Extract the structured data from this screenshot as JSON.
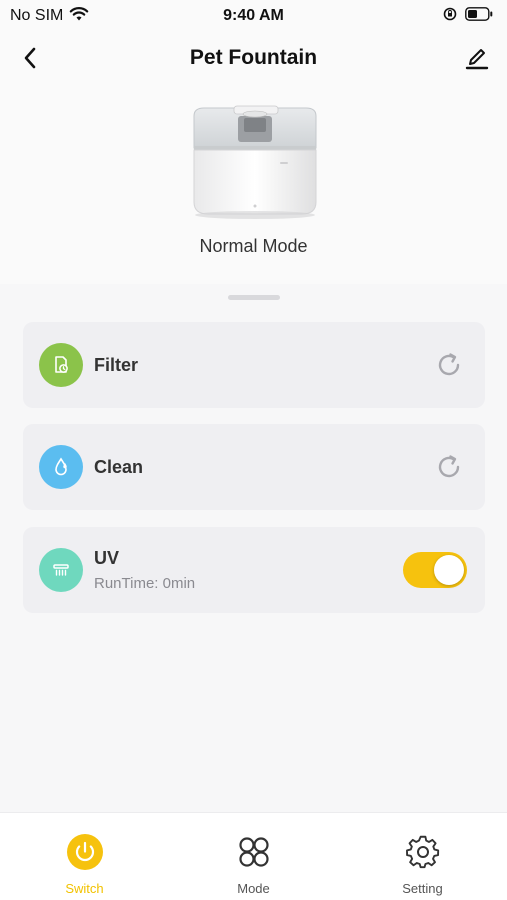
{
  "status_bar": {
    "carrier": "No SIM",
    "time": "9:40 AM"
  },
  "header": {
    "title": "Pet Fountain"
  },
  "device": {
    "mode": "Normal Mode"
  },
  "cards": [
    {
      "title": "Filter",
      "icon": "filter-icon",
      "icon_color": "#8bc34a"
    },
    {
      "title": "Clean",
      "icon": "water-drop-icon",
      "icon_color": "#5bbdf0"
    },
    {
      "title": "UV",
      "subtitle": "RunTime: 0min",
      "icon": "uv-lamp-icon",
      "icon_color": "#6fd8be",
      "toggle_on": true
    }
  ],
  "tabs": [
    {
      "label": "Switch",
      "icon": "power-icon",
      "active": true
    },
    {
      "label": "Mode",
      "icon": "four-circles-icon",
      "active": false
    },
    {
      "label": "Setting",
      "icon": "gear-icon",
      "active": false
    }
  ],
  "colors": {
    "accent": "#f6c20e",
    "background": "#f7f7f8",
    "card": "#efeff2"
  }
}
